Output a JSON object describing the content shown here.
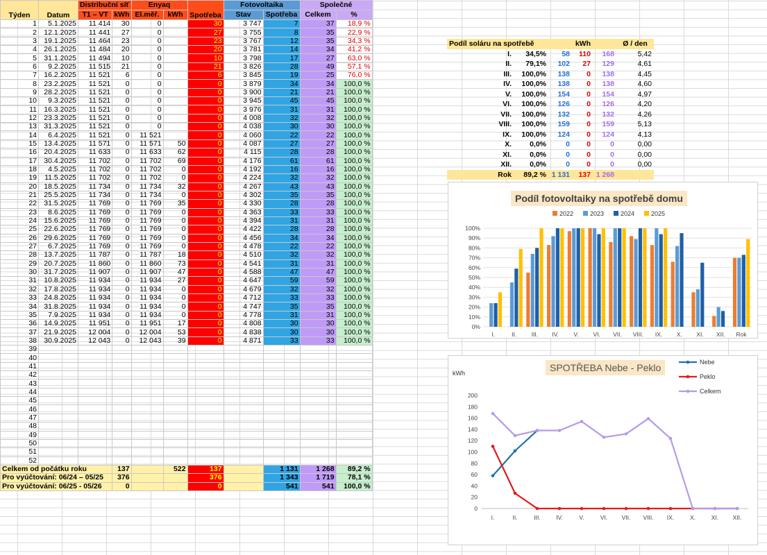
{
  "headers": {
    "tyden": "Týden",
    "datum": "Datum",
    "distrib": "Distribuční síť",
    "distrib_t": "T1 – VT",
    "distrib_kwh": "kWh",
    "enyaq": "Enyaq",
    "enyaq_el": "El.měř.",
    "enyaq_kwh": "kWh",
    "spotreba": "Spotřeba",
    "foto": "Fotovoltaika",
    "foto_stav": "Stav",
    "foto_spotreba": "Spotřeba",
    "spol": "Společné",
    "spol_celkem": "Celkem",
    "spol_pct": "%"
  },
  "rows": [
    [
      "1",
      "5.1.2025",
      "11 414",
      "30",
      "0",
      "",
      "30",
      "3 747",
      "7",
      "37",
      "18,9 %"
    ],
    [
      "2",
      "12.1.2025",
      "11 441",
      "27",
      "0",
      "",
      "27",
      "3 755",
      "8",
      "35",
      "22,9 %"
    ],
    [
      "3",
      "19.1.2025",
      "11 464",
      "23",
      "0",
      "",
      "23",
      "3 767",
      "12",
      "35",
      "34,3 %"
    ],
    [
      "4",
      "26.1.2025",
      "11 484",
      "20",
      "0",
      "",
      "20",
      "3 781",
      "14",
      "34",
      "41,2 %"
    ],
    [
      "5",
      "31.1.2025",
      "11 494",
      "10",
      "0",
      "",
      "10",
      "3 798",
      "17",
      "27",
      "63,0 %"
    ],
    [
      "6",
      "9.2.2025",
      "11 515",
      "21",
      "0",
      "",
      "21",
      "3 826",
      "28",
      "49",
      "57,1 %"
    ],
    [
      "7",
      "16.2.2025",
      "11 521",
      "6",
      "0",
      "",
      "6",
      "3 845",
      "19",
      "25",
      "76,0 %"
    ],
    [
      "8",
      "23.2.2025",
      "11 521",
      "0",
      "0",
      "",
      "0",
      "3 879",
      "34",
      "34",
      "100,0 %"
    ],
    [
      "9",
      "28.2.2025",
      "11 521",
      "0",
      "0",
      "",
      "0",
      "3 900",
      "21",
      "21",
      "100,0 %"
    ],
    [
      "10",
      "9.3.2025",
      "11 521",
      "0",
      "0",
      "",
      "0",
      "3 945",
      "45",
      "45",
      "100,0 %"
    ],
    [
      "11",
      "16.3.2025",
      "11 521",
      "0",
      "0",
      "",
      "0",
      "3 976",
      "31",
      "31",
      "100,0 %"
    ],
    [
      "12",
      "23.3.2025",
      "11 521",
      "0",
      "0",
      "",
      "0",
      "4 008",
      "32",
      "32",
      "100,0 %"
    ],
    [
      "13",
      "31.3.2025",
      "11 521",
      "0",
      "0",
      "",
      "0",
      "4 038",
      "30",
      "30",
      "100,0 %"
    ],
    [
      "14",
      "6.4.2025",
      "11 521",
      "0",
      "11 521",
      "",
      "0",
      "4 060",
      "22",
      "22",
      "100,0 %"
    ],
    [
      "15",
      "13.4.2025",
      "11 571",
      "0",
      "11 571",
      "50",
      "0",
      "4 087",
      "27",
      "27",
      "100,0 %"
    ],
    [
      "16",
      "20.4.2025",
      "11 633",
      "0",
      "11 633",
      "62",
      "0",
      "4 115",
      "28",
      "28",
      "100,0 %"
    ],
    [
      "17",
      "30.4.2025",
      "11 702",
      "0",
      "11 702",
      "69",
      "0",
      "4 176",
      "61",
      "61",
      "100,0 %"
    ],
    [
      "18",
      "4.5.2025",
      "11 702",
      "0",
      "11 702",
      "0",
      "0",
      "4 192",
      "16",
      "16",
      "100,0 %"
    ],
    [
      "19",
      "11.5.2025",
      "11 702",
      "0",
      "11 702",
      "0",
      "0",
      "4 224",
      "32",
      "32",
      "100,0 %"
    ],
    [
      "20",
      "18.5.2025",
      "11 734",
      "0",
      "11 734",
      "32",
      "0",
      "4 267",
      "43",
      "43",
      "100,0 %"
    ],
    [
      "21",
      "25.5.2025",
      "11 734",
      "0",
      "11 734",
      "0",
      "0",
      "4 302",
      "35",
      "35",
      "100,0 %"
    ],
    [
      "22",
      "31.5.2025",
      "11 769",
      "0",
      "11 769",
      "35",
      "0",
      "4 330",
      "28",
      "28",
      "100,0 %"
    ],
    [
      "23",
      "8.6.2025",
      "11 769",
      "0",
      "11 769",
      "0",
      "0",
      "4 363",
      "33",
      "33",
      "100,0 %"
    ],
    [
      "24",
      "15.6.2025",
      "11 769",
      "0",
      "11 769",
      "0",
      "0",
      "4 394",
      "31",
      "31",
      "100,0 %"
    ],
    [
      "25",
      "22.6.2025",
      "11 769",
      "0",
      "11 769",
      "0",
      "0",
      "4 422",
      "28",
      "28",
      "100,0 %"
    ],
    [
      "26",
      "29.6.2025",
      "11 769",
      "0",
      "11 769",
      "0",
      "0",
      "4 456",
      "34",
      "34",
      "100,0 %"
    ],
    [
      "27",
      "6.7.2025",
      "11 769",
      "0",
      "11 769",
      "0",
      "0",
      "4 478",
      "22",
      "22",
      "100,0 %"
    ],
    [
      "28",
      "13.7.2025",
      "11 787",
      "0",
      "11 787",
      "18",
      "0",
      "4 510",
      "32",
      "32",
      "100,0 %"
    ],
    [
      "29",
      "20.7.2025",
      "11 860",
      "0",
      "11 860",
      "73",
      "0",
      "4 541",
      "31",
      "31",
      "100,0 %"
    ],
    [
      "30",
      "31.7.2025",
      "11 907",
      "0",
      "11 907",
      "47",
      "0",
      "4 588",
      "47",
      "47",
      "100,0 %"
    ],
    [
      "31",
      "10.8.2025",
      "11 934",
      "0",
      "11 934",
      "27",
      "0",
      "4 647",
      "59",
      "59",
      "100,0 %"
    ],
    [
      "32",
      "17.8.2025",
      "11 934",
      "0",
      "11 934",
      "0",
      "0",
      "4 679",
      "32",
      "32",
      "100,0 %"
    ],
    [
      "33",
      "24.8.2025",
      "11 934",
      "0",
      "11 934",
      "0",
      "0",
      "4 712",
      "33",
      "33",
      "100,0 %"
    ],
    [
      "34",
      "31.8.2025",
      "11 934",
      "0",
      "11 934",
      "0",
      "0",
      "4 747",
      "35",
      "35",
      "100,0 %"
    ],
    [
      "35",
      "7.9.2025",
      "11 934",
      "0",
      "11 934",
      "0",
      "0",
      "4 778",
      "31",
      "31",
      "100,0 %"
    ],
    [
      "36",
      "14.9.2025",
      "11 951",
      "0",
      "11 951",
      "17",
      "0",
      "4 808",
      "30",
      "30",
      "100,0 %"
    ],
    [
      "37",
      "21.9.2025",
      "12 004",
      "0",
      "12 004",
      "53",
      "0",
      "4 838",
      "30",
      "30",
      "100,0 %"
    ],
    [
      "38",
      "30.9.2025",
      "12 043",
      "0",
      "12 043",
      "39",
      "0",
      "4 871",
      "33",
      "33",
      "100,0 %"
    ],
    [
      "39",
      "",
      "",
      "",
      "",
      "",
      "",
      "",
      "",
      "",
      ""
    ],
    [
      "40",
      "",
      "",
      "",
      "",
      "",
      "",
      "",
      "",
      "",
      ""
    ],
    [
      "41",
      "",
      "",
      "",
      "",
      "",
      "",
      "",
      "",
      "",
      ""
    ],
    [
      "42",
      "",
      "",
      "",
      "",
      "",
      "",
      "",
      "",
      "",
      ""
    ],
    [
      "43",
      "",
      "",
      "",
      "",
      "",
      "",
      "",
      "",
      "",
      ""
    ],
    [
      "44",
      "",
      "",
      "",
      "",
      "",
      "",
      "",
      "",
      "",
      ""
    ],
    [
      "45",
      "",
      "",
      "",
      "",
      "",
      "",
      "",
      "",
      "",
      ""
    ],
    [
      "46",
      "",
      "",
      "",
      "",
      "",
      "",
      "",
      "",
      "",
      ""
    ],
    [
      "47",
      "",
      "",
      "",
      "",
      "",
      "",
      "",
      "",
      "",
      ""
    ],
    [
      "48",
      "",
      "",
      "",
      "",
      "",
      "",
      "",
      "",
      "",
      ""
    ],
    [
      "49",
      "",
      "",
      "",
      "",
      "",
      "",
      "",
      "",
      "",
      ""
    ],
    [
      "50",
      "",
      "",
      "",
      "",
      "",
      "",
      "",
      "",
      "",
      ""
    ],
    [
      "51",
      "",
      "",
      "",
      "",
      "",
      "",
      "",
      "",
      "",
      ""
    ],
    [
      "52",
      "",
      "",
      "",
      "",
      "",
      "",
      "",
      "",
      "",
      ""
    ]
  ],
  "totals": [
    [
      "Celkem od počátku roku",
      "137",
      "",
      "522",
      "137",
      "",
      "1 131",
      "1 268",
      "89,2 %"
    ],
    [
      "Pro vyúčtování: 06/24 – 05/25",
      "376",
      "",
      "",
      "376",
      "",
      "1 343",
      "1 719",
      "78,1 %"
    ],
    [
      "Pro vyúčtování: 06/25 - 05/26",
      "0",
      "",
      "",
      "0",
      "",
      "541",
      "541",
      "100,0 %"
    ]
  ],
  "solar": {
    "title": "Podíl soláru na spotřebě",
    "kwh": "kWh",
    "avg": "Ø  / den",
    "rows": [
      [
        "I.",
        "34,5%",
        "58",
        "110",
        "168",
        "5,42"
      ],
      [
        "II.",
        "79,1%",
        "102",
        "27",
        "129",
        "4,61"
      ],
      [
        "III.",
        "100,0%",
        "138",
        "0",
        "138",
        "4,45"
      ],
      [
        "IV.",
        "100,0%",
        "138",
        "0",
        "138",
        "4,60"
      ],
      [
        "V.",
        "100,0%",
        "154",
        "0",
        "154",
        "4,97"
      ],
      [
        "VI.",
        "100,0%",
        "126",
        "0",
        "126",
        "4,20"
      ],
      [
        "VII.",
        "100,0%",
        "132",
        "0",
        "132",
        "4,26"
      ],
      [
        "VIII.",
        "100,0%",
        "159",
        "0",
        "159",
        "5,13"
      ],
      [
        "IX.",
        "100,0%",
        "124",
        "0",
        "124",
        "4,13"
      ],
      [
        "X.",
        "0,0%",
        "0",
        "0",
        "0",
        "0,00"
      ],
      [
        "XI.",
        "0,0%",
        "0",
        "0",
        "0",
        "0,00"
      ],
      [
        "XII.",
        "0,0%",
        "0",
        "0",
        "0",
        "0,00"
      ]
    ],
    "total": [
      "Rok",
      "89,2 %",
      "1 131",
      "137",
      "1 268"
    ]
  },
  "chart_data": [
    {
      "type": "bar",
      "title": "Podíl fotovoltaiky na spotřebě domu",
      "categories": [
        "I.",
        "II.",
        "III.",
        "IV.",
        "V.",
        "VI.",
        "VII.",
        "VIII.",
        "IX.",
        "X.",
        "XI.",
        "XII.",
        "Rok"
      ],
      "ylim": [
        0,
        100
      ],
      "yticks": [
        "0%",
        "10%",
        "20%",
        "30%",
        "40%",
        "50%",
        "60%",
        "70%",
        "80%",
        "90%",
        "100%"
      ],
      "legend_position": "top",
      "series": [
        {
          "name": "2022",
          "color": "#ed7d31",
          "values": [
            0,
            0,
            55,
            83,
            97,
            100,
            86,
            92,
            83,
            66,
            35,
            11,
            70
          ]
        },
        {
          "name": "2023",
          "color": "#5b9bd5",
          "values": [
            24,
            45,
            74,
            92,
            100,
            100,
            100,
            89,
            100,
            82,
            38,
            20,
            70
          ]
        },
        {
          "name": "2024",
          "color": "#1f5fa8",
          "values": [
            24,
            59,
            80,
            100,
            100,
            94,
            100,
            100,
            94,
            95,
            65,
            16,
            73
          ]
        },
        {
          "name": "2025",
          "color": "#ffc000",
          "values": [
            35,
            79,
            100,
            100,
            100,
            100,
            100,
            100,
            100,
            0,
            0,
            0,
            89
          ]
        }
      ]
    },
    {
      "type": "line",
      "title": "SPOTŘEBA  Nebe - Peklo",
      "ylabel": "kWh",
      "categories": [
        "I.",
        "II.",
        "III.",
        "IV.",
        "V.",
        "VI.",
        "VII.",
        "VIII.",
        "IX.",
        "X.",
        "XI.",
        "XII."
      ],
      "ylim": [
        0,
        200
      ],
      "yticks": [
        "0",
        "20",
        "40",
        "60",
        "80",
        "100",
        "120",
        "140",
        "160",
        "180",
        "200"
      ],
      "legend_position": "top-right",
      "series": [
        {
          "name": "Nebe",
          "color": "#1f6fb2",
          "values": [
            58,
            102,
            138
          ]
        },
        {
          "name": "Peklo",
          "color": "#e31a1c",
          "values": [
            110,
            27,
            0,
            0,
            0,
            0,
            0,
            0,
            0,
            0,
            0,
            0
          ]
        },
        {
          "name": "Celkem",
          "color": "#b59be8",
          "values": [
            168,
            129,
            138,
            138,
            154,
            126,
            132,
            159,
            124,
            0,
            0,
            0
          ]
        }
      ]
    }
  ]
}
